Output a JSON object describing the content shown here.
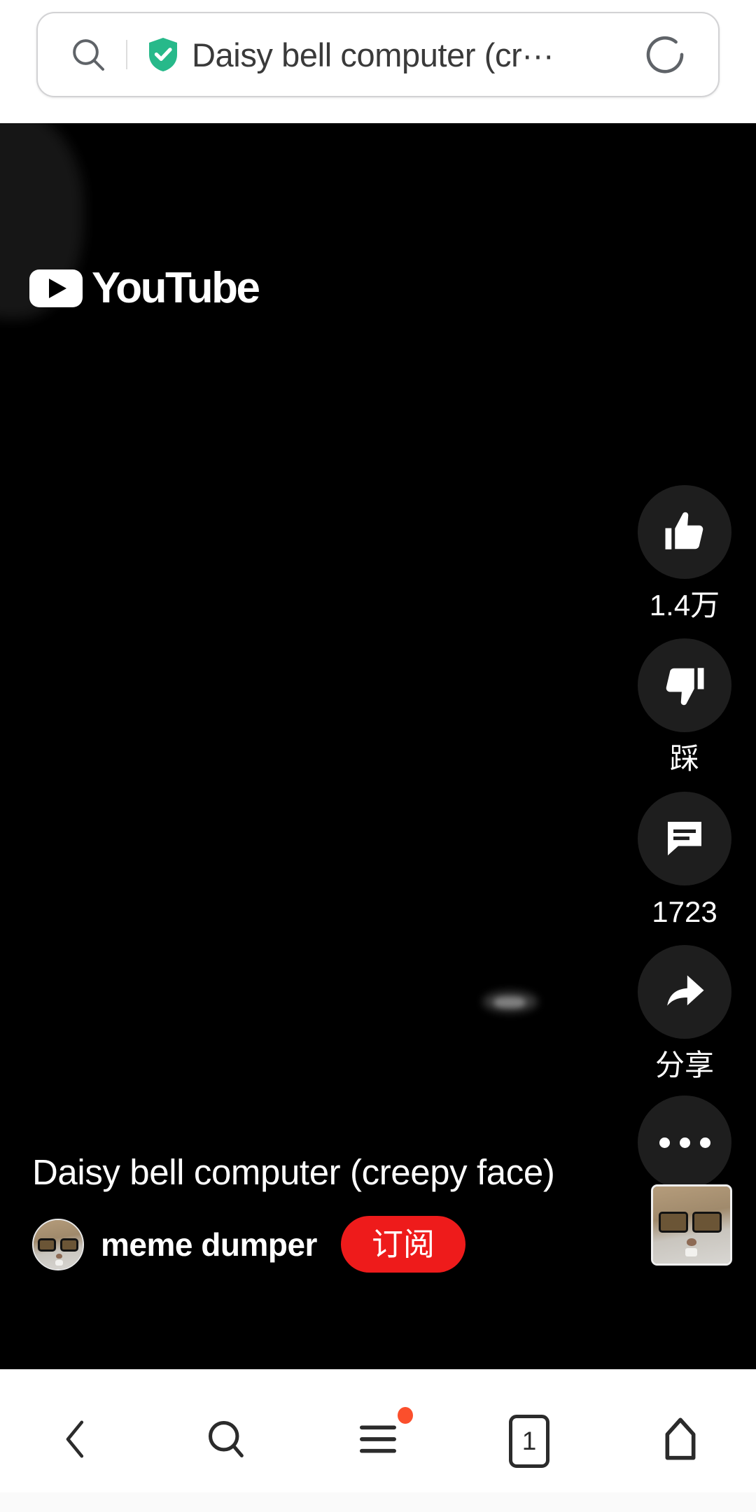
{
  "browser": {
    "search_icon": "search-icon",
    "security_icon": "shield-check-icon",
    "address_text": "Daisy bell computer (cr···",
    "reload_icon": "reload-icon"
  },
  "video": {
    "brand_logo_text": "YouTube",
    "title": "Daisy bell computer (creepy face)",
    "channel_name": "meme dumper",
    "subscribe_label": "订阅",
    "avatar_icon": "channel-avatar-cat",
    "mini_thumbnail_icon": "video-thumbnail-cat"
  },
  "rail": {
    "items": [
      {
        "icon": "thumbs-up-icon",
        "label": "1.4万",
        "name": "like-button"
      },
      {
        "icon": "thumbs-down-icon",
        "label": "踩",
        "name": "dislike-button"
      },
      {
        "icon": "comment-icon",
        "label": "1723",
        "name": "comment-button"
      },
      {
        "icon": "share-icon",
        "label": "分享",
        "name": "share-button"
      },
      {
        "icon": "more-ellipsis-icon",
        "label": "",
        "name": "more-button"
      }
    ]
  },
  "bottom_nav": {
    "items": [
      {
        "icon": "back-chevron-icon",
        "label": "",
        "name": "nav-back"
      },
      {
        "icon": "search-icon",
        "label": "",
        "name": "nav-search"
      },
      {
        "icon": "menu-hamburger-icon",
        "label": "",
        "name": "nav-menu",
        "badge": true
      },
      {
        "icon": "tab-count-icon",
        "label": "1",
        "name": "nav-tabs"
      },
      {
        "icon": "home-icon",
        "label": "",
        "name": "nav-home"
      }
    ]
  },
  "colors": {
    "subscribe_red": "#ee1b1b",
    "badge_red": "#fb4f2c",
    "shield_green": "#27b98a",
    "rail_circle": "#1e1e1e",
    "video_bg": "#000000"
  }
}
